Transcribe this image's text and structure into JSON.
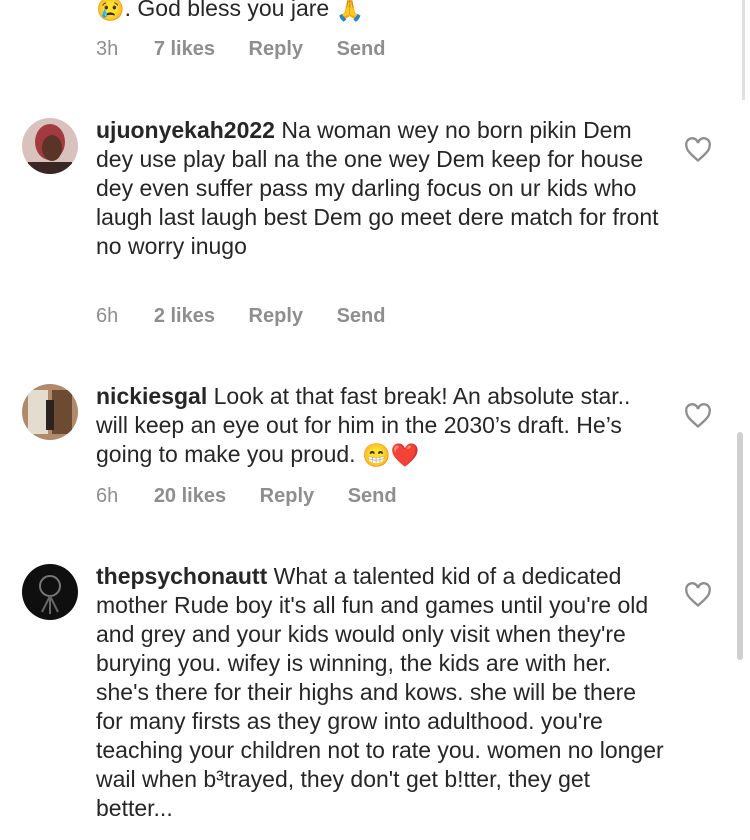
{
  "top": {
    "text": ". God bless you jare",
    "emoji_left": "😢",
    "emoji_right": "🙏"
  },
  "meta0": {
    "time": "3h",
    "likes": "7 likes",
    "reply": "Reply",
    "send": "Send"
  },
  "comments": [
    {
      "username": "ujuonyekah2022",
      "text": " Na woman wey no born pikin Dem dey use play ball  na the one wey Dem keep for house dey even suffer pass my darling focus on ur kids who laugh last laugh best Dem go meet dere match for front no worry inugo",
      "time": "6h",
      "likes": "2 likes",
      "reply": "Reply",
      "send": "Send"
    },
    {
      "username": "nickiesgal",
      "text": " Look at that fast break! An absolute star.. will keep an eye out for him in the 2030’s draft. He’s going to make you proud. ",
      "emoji": "😁❤️",
      "time": "6h",
      "likes": "20 likes",
      "reply": "Reply",
      "send": "Send"
    },
    {
      "username": "thepsychonautt",
      "text": " What a talented kid of a dedicated mother  Rude boy it's all fun and games until you're old and grey and your kids would only visit when they're burying you. wifey is winning, the kids are with her. she's there for their highs and kows. she will be there for many firsts as they grow into adulthood. you're teaching your children not to rate you. women no longer wail when b³trayed, they don't get b!tter, they get better..."
    }
  ]
}
